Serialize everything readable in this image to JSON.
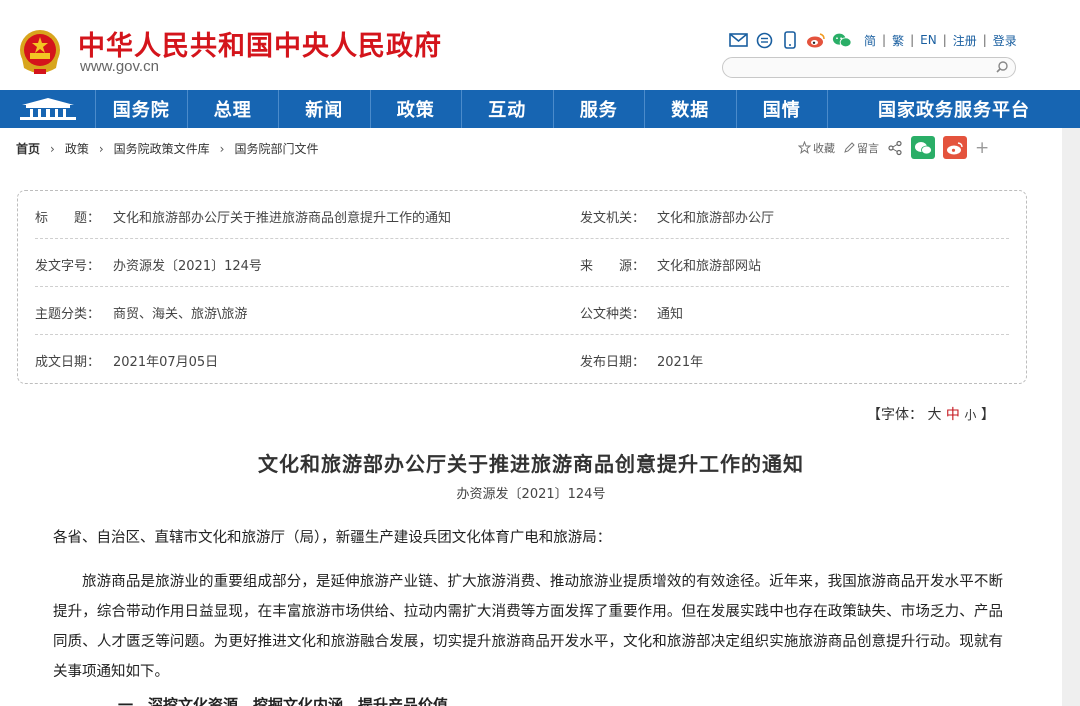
{
  "header": {
    "site_title": "中华人民共和国中央人民政府",
    "site_url": "www.gov.cn",
    "links": [
      "简",
      "繁",
      "EN",
      "注册",
      "登录"
    ],
    "icons": [
      "mail-icon",
      "message-icon",
      "mobile-icon",
      "weibo-icon",
      "wechat-icon"
    ],
    "colors": {
      "brand_red": "#d4141b",
      "nav_blue": "#1765b2"
    }
  },
  "nav": {
    "items": [
      "国务院",
      "总理",
      "新闻",
      "政策",
      "互动",
      "服务",
      "数据",
      "国情",
      "国家政务服务平台"
    ]
  },
  "breadcrumb": {
    "items": [
      "首页",
      "政策",
      "国务院政策文件库",
      "国务院部门文件"
    ]
  },
  "share": {
    "favorite_label": "收藏",
    "comment_label": "留言",
    "plus": "+"
  },
  "info": {
    "title_key": "标　　题：",
    "title_value": "文化和旅游部办公厅关于推进旅游商品创意提升工作的通知",
    "issuer_key": "发文机关：",
    "issuer_value": "文化和旅游部办公厅",
    "docno_key": "发文字号：",
    "docno_value": "办资源发〔2021〕124号",
    "source_key": "来　　源：",
    "source_value": "文化和旅游部网站",
    "topic_key": "主题分类：",
    "topic_value": "商贸、海关、旅游\\旅游",
    "type_key": "公文种类：",
    "type_value": "通知",
    "created_key": "成文日期：",
    "created_value": "2021年07月05日",
    "published_key": "发布日期：",
    "published_value": "2021年"
  },
  "fontsize": {
    "open": "【字体：",
    "large": "大",
    "medium": "中",
    "small": "小",
    "close": "】"
  },
  "article": {
    "title": "文化和旅游部办公厅关于推进旅游商品创意提升工作的通知",
    "doc_number": "办资源发〔2021〕124号",
    "greeting": "各省、自治区、直辖市文化和旅游厅（局），新疆生产建设兵团文化体育广电和旅游局：",
    "paragraph": "旅游商品是旅游业的重要组成部分，是延伸旅游产业链、扩大旅游消费、推动旅游业提质增效的有效途径。近年来，我国旅游商品开发水平不断提升，综合带动作用日益显现，在丰富旅游市场供给、拉动内需扩大消费等方面发挥了重要作用。但在发展实践中也存在政策缺失、市场乏力、产品同质、人才匮乏等问题。为更好推进文化和旅游融合发展，切实提升旅游商品开发水平，文化和旅游部决定组织实施旅游商品创意提升行动。现就有关事项通知如下。",
    "next_heading": "一、深挖文化资源，挖掘文化内涵，提升产品价值"
  }
}
